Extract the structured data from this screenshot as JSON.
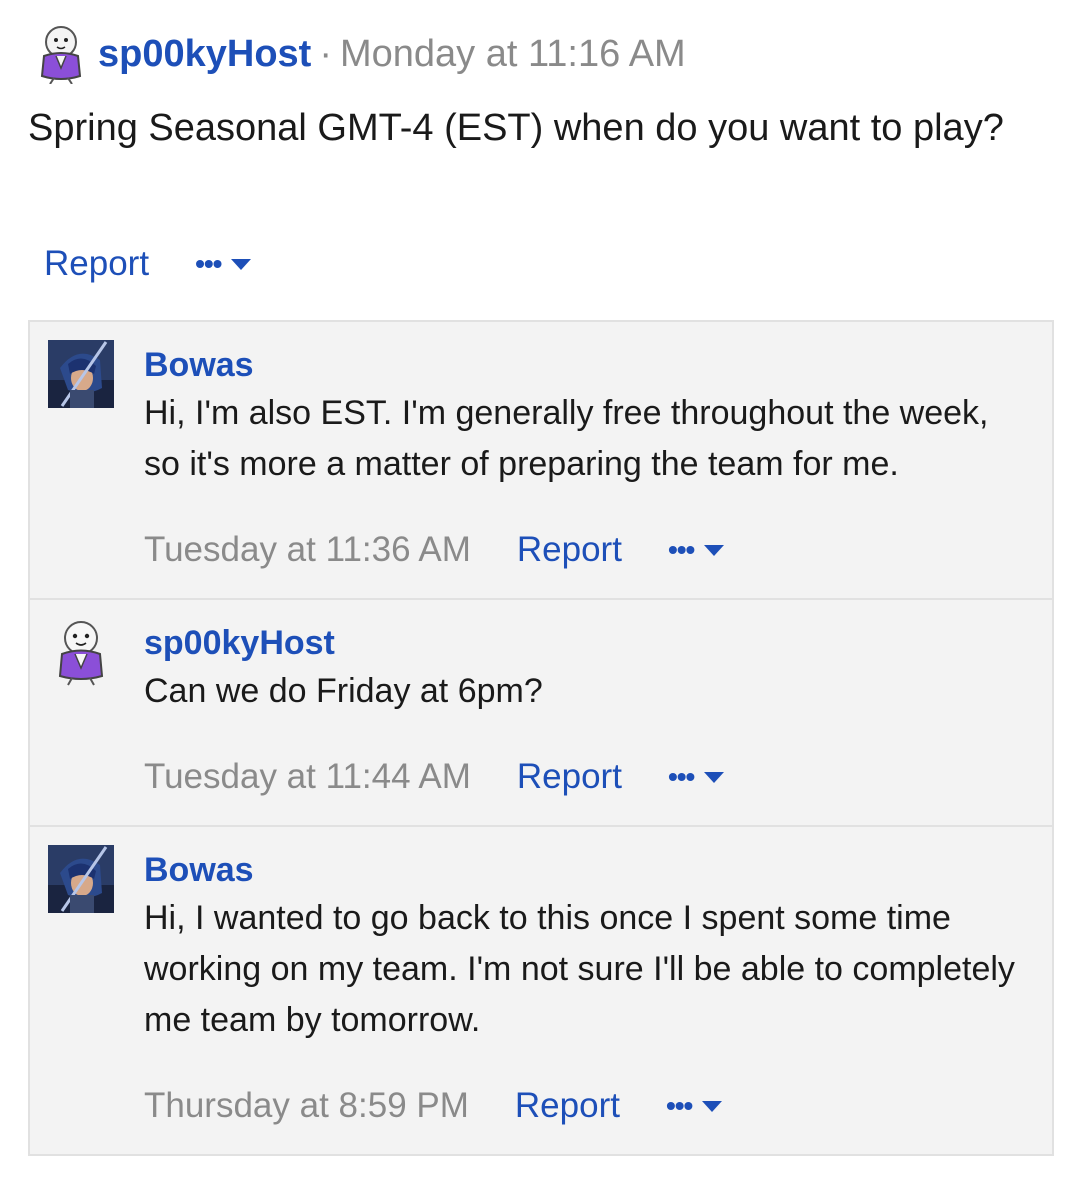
{
  "post": {
    "author": "sp00kyHost",
    "separator": "·",
    "time": "Monday at 11:16 AM",
    "body": "Spring Seasonal GMT-4 (EST) when do you want to play?",
    "report_label": "Report",
    "more_label": "•••"
  },
  "replies": [
    {
      "author": "Bowas",
      "text": "Hi, I'm also EST. I'm generally free throughout the week, so it's more a matter of preparing the team for me.",
      "time": "Tuesday at 11:36 AM",
      "report_label": "Report",
      "more_label": "•••"
    },
    {
      "author": "sp00kyHost",
      "text": "Can we do Friday at 6pm?",
      "time": "Tuesday at 11:44 AM",
      "report_label": "Report",
      "more_label": "•••"
    },
    {
      "author": "Bowas",
      "text": "Hi, I wanted to go back to this once I spent some time working on my team. I'm not sure I'll be able to completely me team by tomorrow.",
      "time": "Thursday at 8:59 PM",
      "report_label": "Report",
      "more_label": "•••"
    }
  ],
  "colors": {
    "link": "#1d4fb8",
    "muted": "#8a8a8a",
    "panel_bg": "#f3f3f3",
    "ghost_purple": "#8b4fd8"
  }
}
